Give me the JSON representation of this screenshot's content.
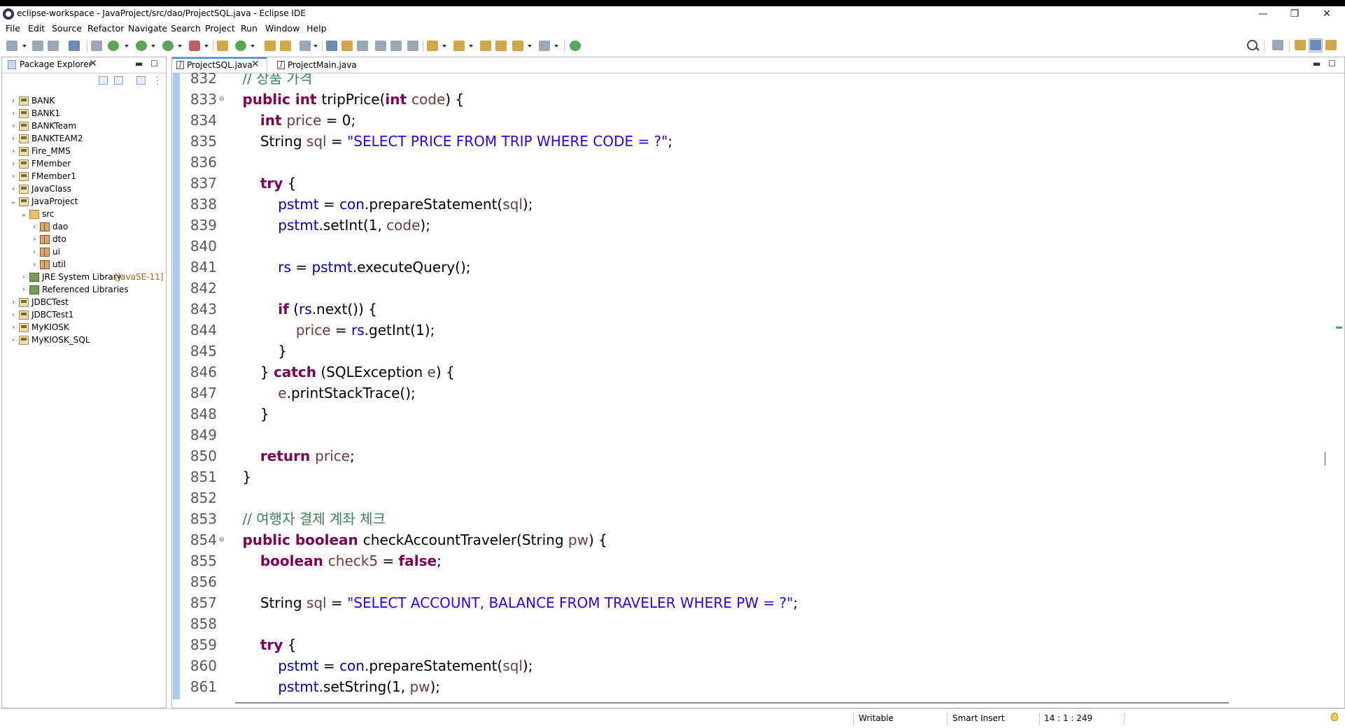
{
  "window": {
    "title": "eclipse-workspace - JavaProject/src/dao/ProjectSQL.java - Eclipse IDE",
    "minimize": "—",
    "restore": "❐",
    "close": "✕"
  },
  "menu": [
    "File",
    "Edit",
    "Source",
    "Refactor",
    "Navigate",
    "Search",
    "Project",
    "Run",
    "Window",
    "Help"
  ],
  "package_explorer": {
    "tab_label": "Package Explorer",
    "close": "✕",
    "minimize": "▬",
    "maximize": "☐",
    "items": [
      {
        "label": "BANK",
        "type": "project",
        "expanded": false,
        "depth": 0
      },
      {
        "label": "BANK1",
        "type": "project",
        "expanded": false,
        "depth": 0
      },
      {
        "label": "BANKTeam",
        "type": "project",
        "expanded": false,
        "depth": 0
      },
      {
        "label": "BANKTEAM2",
        "type": "project",
        "expanded": false,
        "depth": 0
      },
      {
        "label": "Fire_MMS",
        "type": "project",
        "expanded": false,
        "depth": 0
      },
      {
        "label": "FMember",
        "type": "project",
        "expanded": false,
        "depth": 0
      },
      {
        "label": "FMember1",
        "type": "project",
        "expanded": false,
        "depth": 0
      },
      {
        "label": "JavaClass",
        "type": "project",
        "expanded": false,
        "depth": 0
      },
      {
        "label": "JavaProject",
        "type": "project",
        "expanded": true,
        "depth": 0
      },
      {
        "label": "src",
        "type": "folder",
        "expanded": true,
        "depth": 1
      },
      {
        "label": "dao",
        "type": "pkg",
        "expanded": false,
        "depth": 2
      },
      {
        "label": "dto",
        "type": "pkg",
        "expanded": false,
        "depth": 2
      },
      {
        "label": "ui",
        "type": "pkg",
        "expanded": false,
        "depth": 2
      },
      {
        "label": "util",
        "type": "pkg",
        "expanded": false,
        "depth": 2
      },
      {
        "label": "JRE System Library",
        "decoration": "[JavaSE-11]",
        "type": "lib",
        "expanded": false,
        "depth": 1
      },
      {
        "label": "Referenced Libraries",
        "type": "lib",
        "expanded": false,
        "depth": 1
      },
      {
        "label": "JDBCTest",
        "type": "project",
        "expanded": false,
        "depth": 0
      },
      {
        "label": "JDBCTest1",
        "type": "project",
        "expanded": false,
        "depth": 0
      },
      {
        "label": "MyKIOSK",
        "type": "project",
        "expanded": false,
        "depth": 0
      },
      {
        "label": "MyKIOSK_SQL",
        "type": "project",
        "expanded": false,
        "depth": 0
      }
    ]
  },
  "editor": {
    "tabs": [
      {
        "label": "ProjectSQL.java",
        "active": true,
        "close": "✕"
      },
      {
        "label": "ProjectMain.java",
        "active": false
      }
    ],
    "icon_letter": "J",
    "minimize": "▬",
    "maximize": "☐",
    "lines": [
      {
        "num": "832",
        "fold": "",
        "tokens": [
          [
            "",
            "    "
          ],
          [
            "cm",
            "// 상품 가격"
          ]
        ]
      },
      {
        "num": "833",
        "fold": "⊖",
        "tokens": [
          [
            "",
            "    "
          ],
          [
            "kw",
            "public int "
          ],
          [
            "",
            "tripPrice("
          ],
          [
            "kw",
            "int "
          ],
          [
            "var",
            "code"
          ],
          [
            "",
            ") {"
          ]
        ]
      },
      {
        "num": "834",
        "fold": "",
        "tokens": [
          [
            "",
            "        "
          ],
          [
            "kw",
            "int "
          ],
          [
            "var",
            "price"
          ],
          [
            "",
            " = 0;"
          ]
        ]
      },
      {
        "num": "835",
        "fold": "",
        "tokens": [
          [
            "",
            "        String "
          ],
          [
            "var",
            "sql"
          ],
          [
            "",
            " = "
          ],
          [
            "str",
            "\"SELECT PRICE FROM TRIP WHERE CODE = ?\""
          ],
          [
            "",
            ";"
          ]
        ]
      },
      {
        "num": "836",
        "fold": "",
        "tokens": []
      },
      {
        "num": "837",
        "fold": "",
        "tokens": [
          [
            "",
            "        "
          ],
          [
            "kw",
            "try"
          ],
          [
            "",
            " {"
          ]
        ]
      },
      {
        "num": "838",
        "fold": "",
        "tokens": [
          [
            "",
            "            "
          ],
          [
            "fld",
            "pstmt"
          ],
          [
            "",
            " = "
          ],
          [
            "fld",
            "con"
          ],
          [
            "",
            ".prepareStatement("
          ],
          [
            "var",
            "sql"
          ],
          [
            "",
            ");"
          ]
        ]
      },
      {
        "num": "839",
        "fold": "",
        "tokens": [
          [
            "",
            "            "
          ],
          [
            "fld",
            "pstmt"
          ],
          [
            "",
            ".setInt(1, "
          ],
          [
            "var",
            "code"
          ],
          [
            "",
            ");"
          ]
        ]
      },
      {
        "num": "840",
        "fold": "",
        "tokens": []
      },
      {
        "num": "841",
        "fold": "",
        "tokens": [
          [
            "",
            "            "
          ],
          [
            "fld",
            "rs"
          ],
          [
            "",
            " = "
          ],
          [
            "fld",
            "pstmt"
          ],
          [
            "",
            ".executeQuery();"
          ]
        ]
      },
      {
        "num": "842",
        "fold": "",
        "tokens": []
      },
      {
        "num": "843",
        "fold": "",
        "tokens": [
          [
            "",
            "            "
          ],
          [
            "kw",
            "if"
          ],
          [
            "",
            " ("
          ],
          [
            "fld",
            "rs"
          ],
          [
            "",
            ".next()) {"
          ]
        ]
      },
      {
        "num": "844",
        "fold": "",
        "tokens": [
          [
            "",
            "                "
          ],
          [
            "var",
            "price"
          ],
          [
            "",
            " = "
          ],
          [
            "fld",
            "rs"
          ],
          [
            "",
            ".getInt(1);"
          ]
        ]
      },
      {
        "num": "845",
        "fold": "",
        "tokens": [
          [
            "",
            "            }"
          ]
        ]
      },
      {
        "num": "846",
        "fold": "",
        "tokens": [
          [
            "",
            "        } "
          ],
          [
            "kw",
            "catch"
          ],
          [
            "",
            " (SQLException "
          ],
          [
            "var",
            "e"
          ],
          [
            "",
            ") {"
          ]
        ]
      },
      {
        "num": "847",
        "fold": "",
        "tokens": [
          [
            "",
            "            "
          ],
          [
            "var",
            "e"
          ],
          [
            "",
            ".printStackTrace();"
          ]
        ]
      },
      {
        "num": "848",
        "fold": "",
        "tokens": [
          [
            "",
            "        }"
          ]
        ]
      },
      {
        "num": "849",
        "fold": "",
        "tokens": []
      },
      {
        "num": "850",
        "fold": "",
        "tokens": [
          [
            "",
            "        "
          ],
          [
            "kw",
            "return "
          ],
          [
            "var",
            "price"
          ],
          [
            "",
            ";"
          ]
        ]
      },
      {
        "num": "851",
        "fold": "",
        "tokens": [
          [
            "",
            "    }"
          ]
        ]
      },
      {
        "num": "852",
        "fold": "",
        "tokens": []
      },
      {
        "num": "853",
        "fold": "",
        "tokens": [
          [
            "",
            "    "
          ],
          [
            "cm",
            "// 여행자 결제 계좌 체크"
          ]
        ]
      },
      {
        "num": "854",
        "fold": "⊖",
        "tokens": [
          [
            "",
            "    "
          ],
          [
            "kw",
            "public boolean "
          ],
          [
            "",
            "checkAccountTraveler(String "
          ],
          [
            "var",
            "pw"
          ],
          [
            "",
            ") {"
          ]
        ]
      },
      {
        "num": "855",
        "fold": "",
        "tokens": [
          [
            "",
            "        "
          ],
          [
            "kw",
            "boolean "
          ],
          [
            "var",
            "check5"
          ],
          [
            "",
            " = "
          ],
          [
            "kw",
            "false"
          ],
          [
            "",
            ";"
          ]
        ]
      },
      {
        "num": "856",
        "fold": "",
        "tokens": []
      },
      {
        "num": "857",
        "fold": "",
        "tokens": [
          [
            "",
            "        String "
          ],
          [
            "var",
            "sql"
          ],
          [
            "",
            " = "
          ],
          [
            "str",
            "\"SELECT ACCOUNT, BALANCE FROM TRAVELER WHERE PW = ?\""
          ],
          [
            "",
            ";"
          ]
        ]
      },
      {
        "num": "858",
        "fold": "",
        "tokens": []
      },
      {
        "num": "859",
        "fold": "",
        "tokens": [
          [
            "",
            "        "
          ],
          [
            "kw",
            "try"
          ],
          [
            "",
            " {"
          ]
        ]
      },
      {
        "num": "860",
        "fold": "",
        "tokens": [
          [
            "",
            "            "
          ],
          [
            "fld",
            "pstmt"
          ],
          [
            "",
            " = "
          ],
          [
            "fld",
            "con"
          ],
          [
            "",
            ".prepareStatement("
          ],
          [
            "var",
            "sql"
          ],
          [
            "",
            ");"
          ]
        ]
      },
      {
        "num": "861",
        "fold": "",
        "tokens": [
          [
            "",
            "            "
          ],
          [
            "fld",
            "pstmt"
          ],
          [
            "",
            ".setString(1, "
          ],
          [
            "var",
            "pw"
          ],
          [
            "",
            ");"
          ]
        ]
      }
    ]
  },
  "status": {
    "writable": "Writable",
    "insert_mode": "Smart Insert",
    "position": "14 : 1 : 249"
  },
  "colors": {
    "keyword": "#7f0055",
    "string": "#2a00ff",
    "comment": "#3f7f5f",
    "field": "#0000c0",
    "local_variable": "#6a3e3e",
    "ruler_blue": "#a8cbee",
    "tab_accent": "#4a86d6"
  }
}
